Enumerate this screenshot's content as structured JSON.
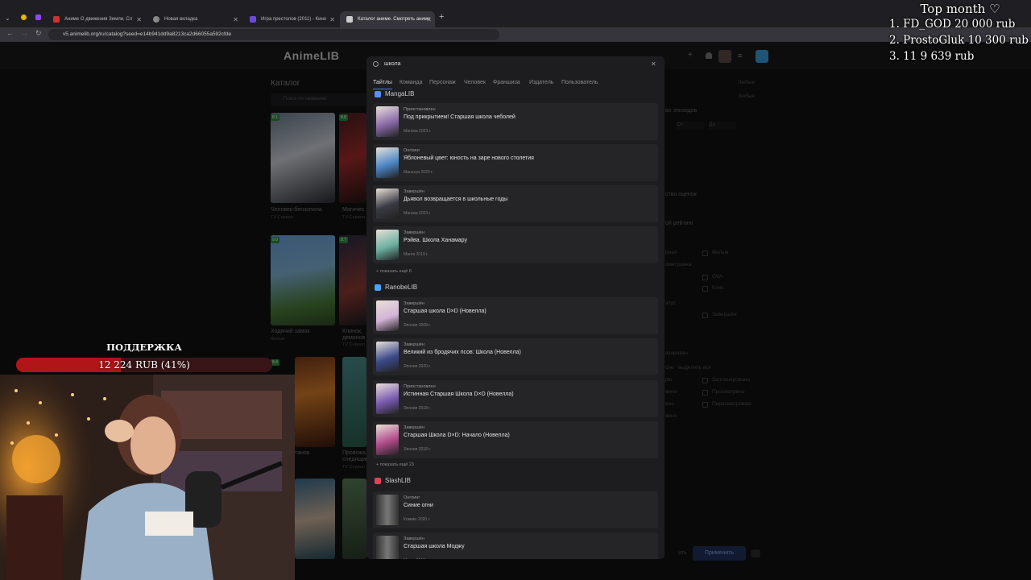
{
  "browser": {
    "tabs": [
      {
        "label": "Аниме О движения Земли, Сл",
        "active": false
      },
      {
        "label": "Новая вкладка",
        "active": false
      },
      {
        "label": "Игра престолов (2011) - Кино",
        "active": false
      },
      {
        "label": "Каталог аниме. Смотреть аниме",
        "active": true
      }
    ],
    "new_tab_symbol": "+",
    "url": "v5.animelib.org/ru/catalog?seed=e14b941dd9a8213ca2d66055a592cfde"
  },
  "site": {
    "logo": "AnimeLIB",
    "catalog_title": "Каталог",
    "catalog_search_placeholder": "Поиск по названию",
    "cards": [
      {
        "title": "Человек-бензопила",
        "type": "TV Сериал",
        "badge": "8.1"
      },
      {
        "title": "Магичес",
        "type": "TV Сериал",
        "badge": "8.8"
      },
      {
        "title": "Ходячий замок",
        "type": "Фильм",
        "badge": "9.0"
      },
      {
        "title": "Клинок, демонов",
        "type": "TV Сериал",
        "badge": "8.7"
      },
      {
        "title": "танов",
        "type": "",
        "badge": "8.4"
      },
      {
        "title": "Провожа следящий",
        "type": "TV Сериал",
        "badge": ""
      }
    ],
    "filters": {
      "episodes": "во эпизодов",
      "ratings_count": "ство оценок",
      "my_rating": "ой рейтинг",
      "from_ph": "От",
      "to_ph": "До",
      "any1": "Любые",
      "any2": "Любые",
      "types": [
        "Фильм",
        "OVA",
        "Клип"
      ],
      "type_left": [
        "риал",
        "ометражка"
      ],
      "status_left": "Завершён",
      "list_statuses": [
        "Запланировано",
        "Просмотрено",
        "Пересматриваю"
      ],
      "list_left": [
        "рю",
        "вено",
        "ено",
        "вено"
      ],
      "misc": [
        "атус",
        "азирован",
        "сие",
        "выделить все"
      ],
      "reset": "ить",
      "apply": "Применить"
    }
  },
  "search_panel": {
    "query": "школа",
    "tabs": [
      "Тайтлы",
      "Команда",
      "Персонаж",
      "Человек",
      "Франшиза",
      "Издатель",
      "Пользователь"
    ],
    "groups": [
      {
        "name": "MangaLIB",
        "icon": "mangalib-logo-icon",
        "color": "#5b8cff",
        "items": [
          {
            "status": "Приостановлен",
            "title": "Под прикрытием! Старшая школа чеболей",
            "kind": "Манхва",
            "year": "2023 г."
          },
          {
            "status": "Онгоинг",
            "title": "Яблоневый цвет: юность на заре нового столетия",
            "kind": "Маньхуа",
            "year": "2020 г."
          },
          {
            "status": "Завершён",
            "title": "Дьявол возвращается в школьные годы",
            "kind": "Манхва",
            "year": "2023 г."
          },
          {
            "status": "Завершён",
            "title": "Рэйва. Школа Ханамару",
            "kind": "Манга",
            "year": "2019 г."
          }
        ],
        "more": "+ показать ещё 6"
      },
      {
        "name": "RanobeLIB",
        "icon": "ranobelib-logo-icon",
        "color": "#4aa3ff",
        "items": [
          {
            "status": "Завершён",
            "title": "Старшая школа D×D (Новелла)",
            "kind": "Япония",
            "year": "2008 г."
          },
          {
            "status": "Завершён",
            "title": "Великий из бродячих псов: Школа (Новелла)",
            "kind": "Япония",
            "year": "2020 г."
          },
          {
            "status": "Приостановлен",
            "title": "Истинная Старшая Школа D×D (Новелла)",
            "kind": "Япония",
            "year": "2018 г."
          },
          {
            "status": "Завершён",
            "title": "Старшая Школа D×D: Начало (Новелла)",
            "kind": "Япония",
            "year": "2018 г."
          }
        ],
        "more": "+ показать ещё 23"
      },
      {
        "name": "SlashLIB",
        "icon": "slashlib-logo-icon",
        "color": "#e0415a",
        "items": [
          {
            "status": "Онгоинг",
            "title": "Синие огни",
            "kind": "Комикс",
            "year": "2020 г."
          },
          {
            "status": "Завершён",
            "title": "Старшая школа Моджу",
            "kind": "Манга",
            "year": "2016 г."
          }
        ]
      }
    ]
  },
  "stream_overlay": {
    "top_month_title": "Top month ♡",
    "top_donors": [
      "1. FD_GOD 20 000 rub",
      "2. ProstoGluk 10 300 rub",
      "3. 11 9 639 rub"
    ],
    "support_title": "ПОДДЕРЖКА",
    "support_amount": "12 224 RUB (41%)",
    "support_progress": 0.41
  },
  "colors": {
    "accent": "#4a7de0",
    "support_bar": "#b01518"
  }
}
